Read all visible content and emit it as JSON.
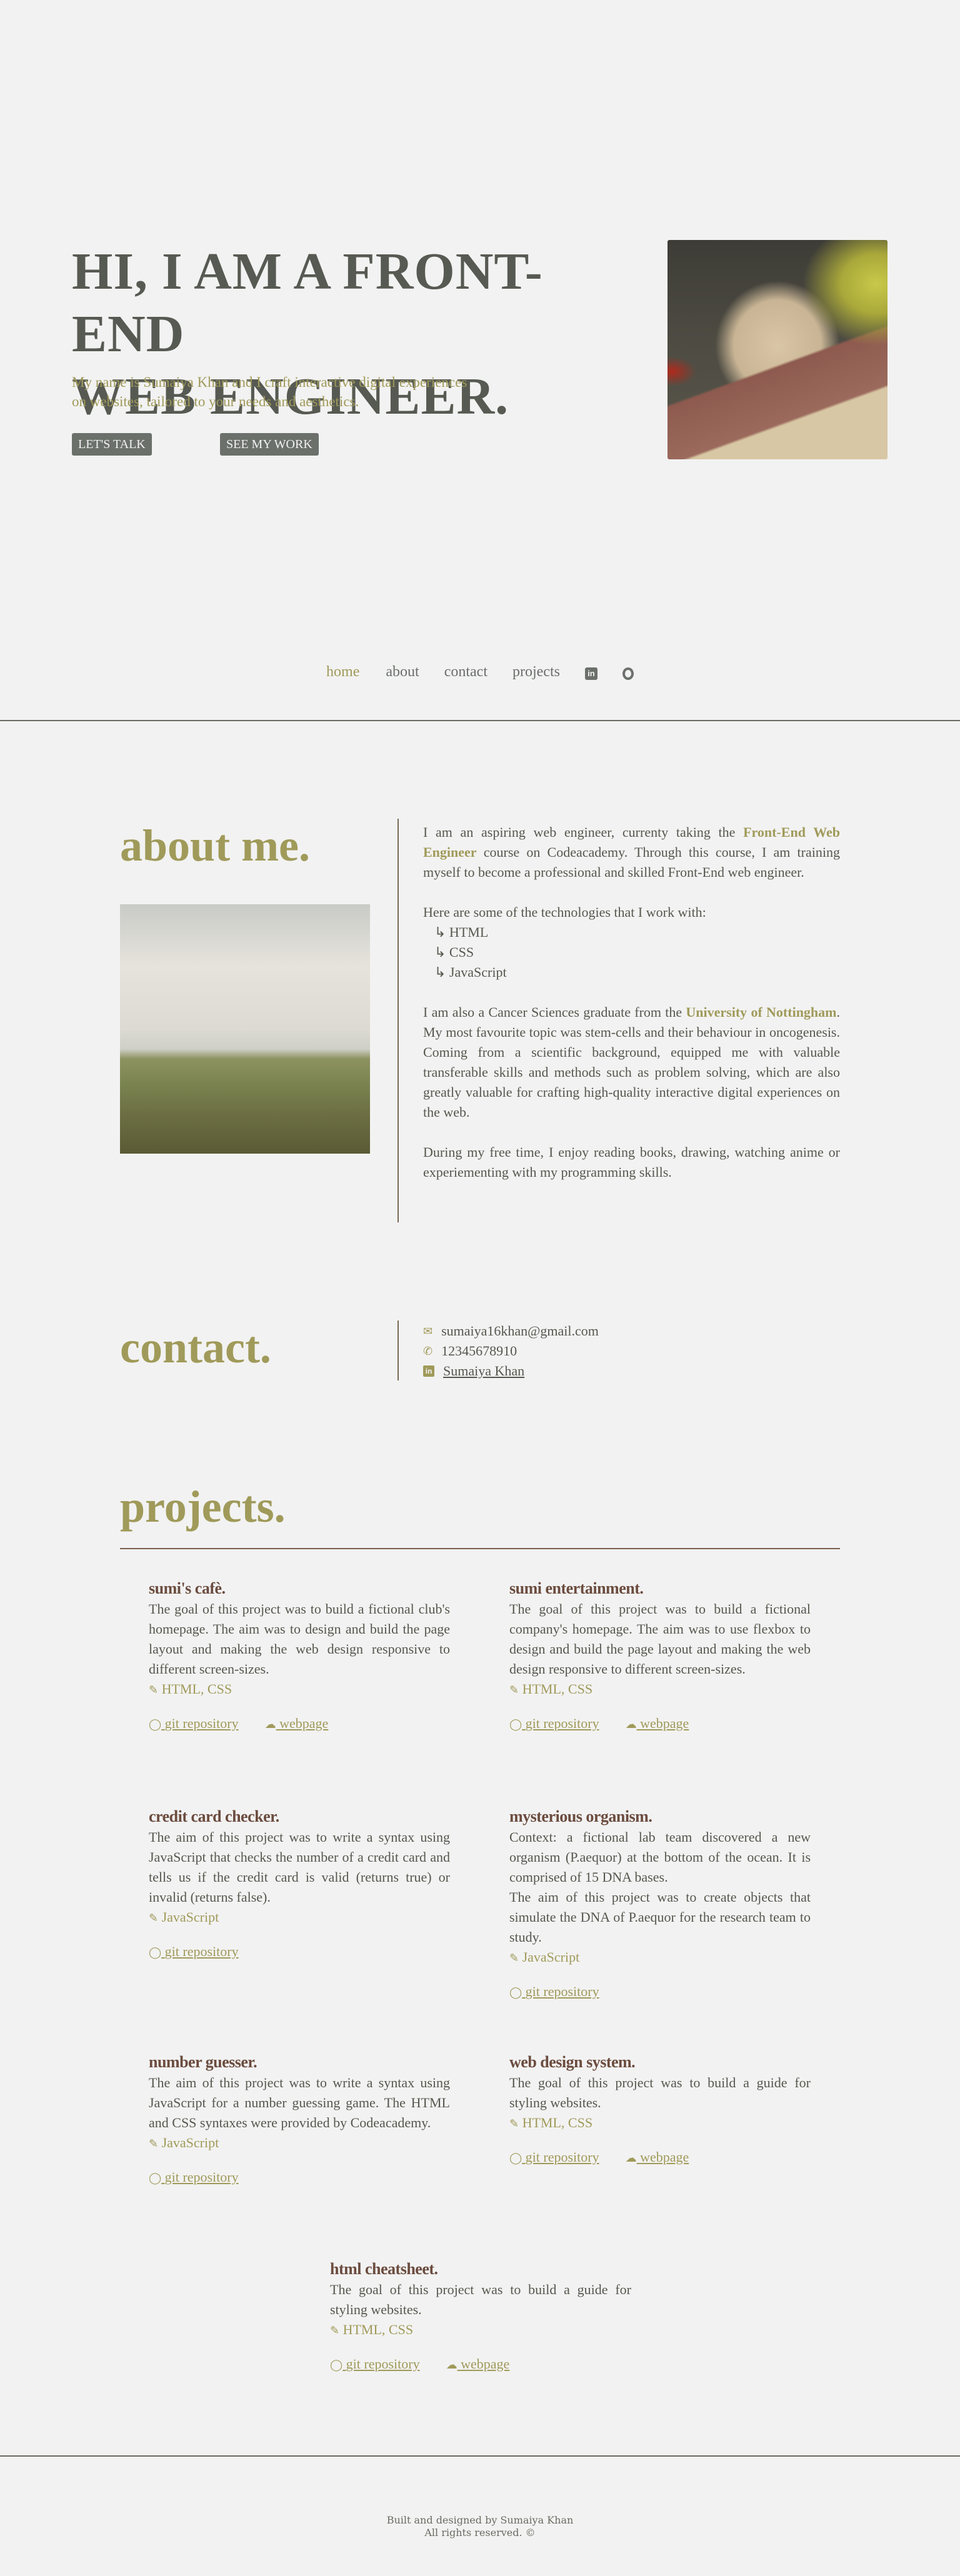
{
  "hero": {
    "title_line1": "HI, I AM A FRONT-END",
    "title_line2": "WEB ENGINEER.",
    "subtitle_line1": "My name is Sumaiya Khan and I craft interactive digital experiences",
    "subtitle_line2": "on websites, tailored to your needs and aesthetics.",
    "btn_talk": "LET'S TALK",
    "btn_work": "SEE MY WORK"
  },
  "nav": {
    "home": "home",
    "about": "about",
    "contact": "contact",
    "projects": "projects",
    "linkedin_icon": "linkedin-icon",
    "github_icon": "github-icon"
  },
  "about": {
    "heading": "about me.",
    "p1_a": "I am an aspiring web engineer, currenty taking the ",
    "p1_link": "Front-End Web Engineer",
    "p1_b": " course on Codeacademy. Through this course, I am training myself to become a professional and skilled Front-End web engineer.",
    "tech_intro": "Here are some of the technologies that I work with:",
    "tech": [
      "↳ HTML",
      "↳ CSS",
      "↳ JavaScript"
    ],
    "p2_a": "I am also a Cancer Sciences graduate from the ",
    "p2_link": "University of Nottingham",
    "p2_b": ". My most favourite topic was stem-cells and their behaviour in oncogenesis. Coming from a scientific background, equipped me with valuable transferable skills and methods such as problem solving, which are also greatly valuable for crafting high-quality interactive digital experiences on the web.",
    "p3": "During my free time, I enjoy reading books, drawing, watching anime or experiementing with my programming skills."
  },
  "contact": {
    "heading": "contact.",
    "email": "sumaiya16khan@gmail.com",
    "phone": "12345678910",
    "linkedin": "Sumaiya Khan"
  },
  "projects": {
    "heading": "projects.",
    "git_label": "git repository",
    "web_label": "webpage",
    "items": [
      {
        "title": "sumi's cafè.",
        "desc": "The goal of this project was to build a fictional club's homepage. The aim was to design and build the page layout and making the web design responsive to different screen-sizes.",
        "tags": "HTML, CSS"
      },
      {
        "title": "sumi entertainment.",
        "desc": "The goal of this project was to build a fictional company's homepage. The aim was to use flexbox to design and build the page layout and making the web design responsive to different screen-sizes.",
        "tags": "HTML, CSS"
      },
      {
        "title": "credit card checker.",
        "desc": "The aim of this project was to write a syntax using JavaScript that checks the number of a credit card and tells us if the credit card is valid (returns true) or invalid (returns false).",
        "tags": "JavaScript"
      },
      {
        "title": "mysterious organism.",
        "desc": "Context: a fictional lab team discovered a new organism (P.aequor) at the bottom of the ocean. It is comprised of 15 DNA bases.",
        "desc2": "The aim of this project was to create objects that simulate the DNA of P.aequor for the research team to study.",
        "tags": "JavaScript"
      },
      {
        "title": "number guesser.",
        "desc": "The aim of this project was to write a syntax using JavaScript for a number guessing game. The HTML and CSS syntaxes were provided by Codeacademy.",
        "tags": "JavaScript"
      },
      {
        "title": "web design system.",
        "desc": "The goal of this project was to build a guide for styling websites.",
        "tags": "HTML, CSS"
      },
      {
        "title": "html cheatsheet.",
        "desc": "The goal of this project was to build a guide for styling websites.",
        "tags": "HTML, CSS"
      }
    ]
  },
  "footer": {
    "line1": "Built and designed by Sumaiya Khan",
    "line2": "All rights reserved. ©"
  },
  "colors": {
    "bg": "#f2f2f2",
    "accent": "#a09a5a",
    "title_brown": "#6b4c3f",
    "button": "#6b706b"
  }
}
